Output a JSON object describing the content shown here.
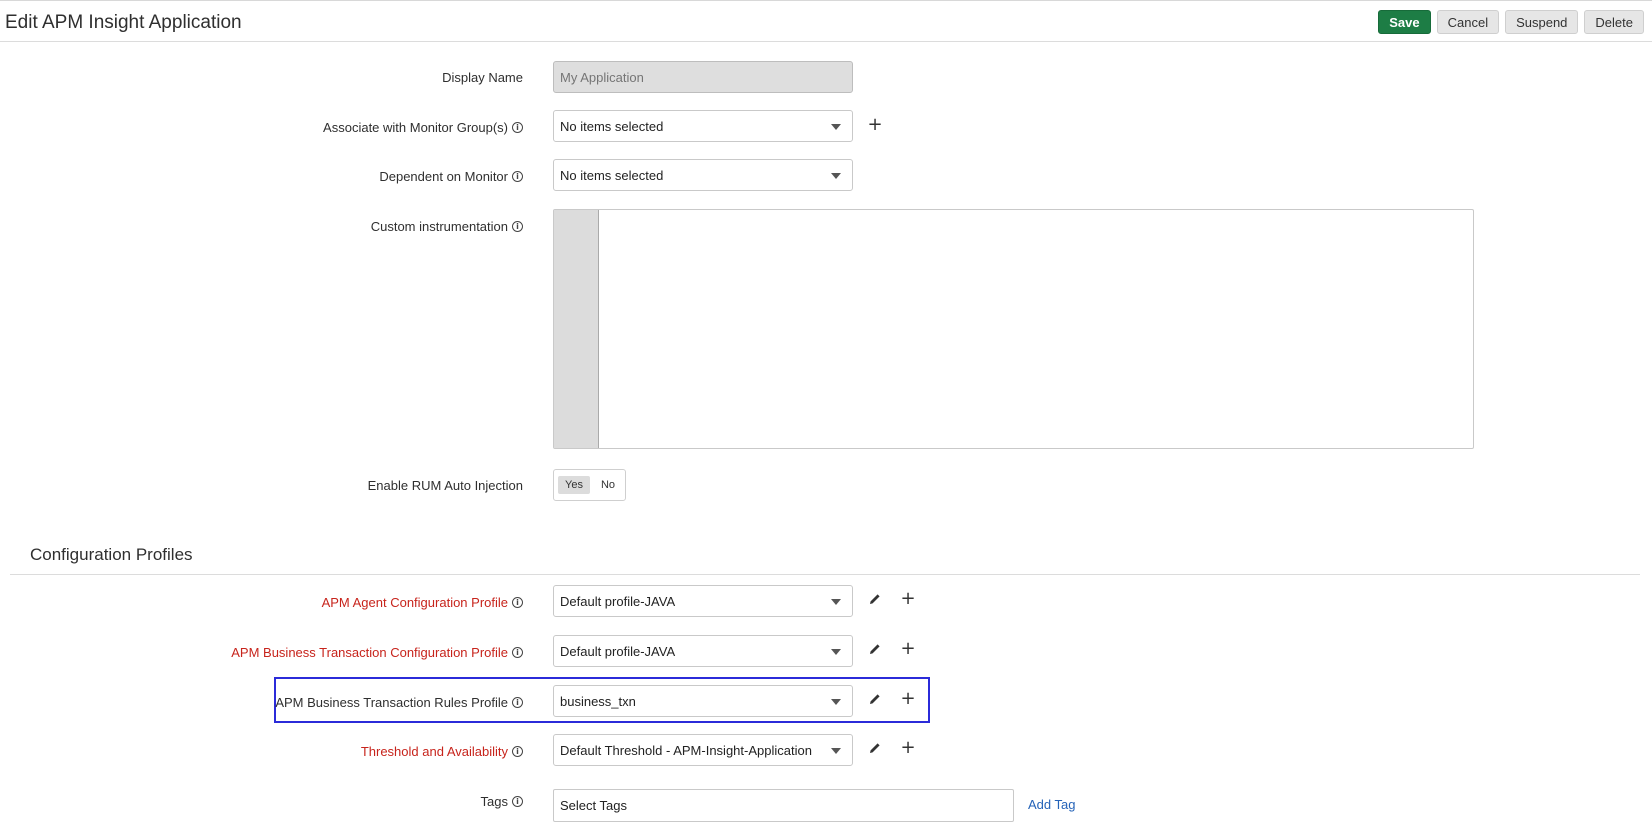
{
  "header": {
    "title": "Edit APM Insight Application",
    "buttons": {
      "save": "Save",
      "cancel": "Cancel",
      "suspend": "Suspend",
      "delete": "Delete"
    }
  },
  "form": {
    "display_name": {
      "label": "Display Name",
      "placeholder": "My Application"
    },
    "monitor_groups": {
      "label": "Associate with Monitor Group(s)",
      "value": "No items selected"
    },
    "dependent_monitor": {
      "label": "Dependent on Monitor",
      "value": "No items selected"
    },
    "custom_instrumentation": {
      "label": "Custom instrumentation"
    },
    "rum_injection": {
      "label": "Enable RUM Auto Injection",
      "yes": "Yes",
      "no": "No",
      "selected": "Yes"
    }
  },
  "config_profiles": {
    "title": "Configuration Profiles",
    "agent_profile": {
      "label": "APM Agent Configuration Profile",
      "value": "Default profile-JAVA"
    },
    "bt_config_profile": {
      "label": "APM Business Transaction Configuration Profile",
      "value": "Default profile-JAVA"
    },
    "bt_rules_profile": {
      "label": "APM Business Transaction Rules Profile",
      "value": "business_txn"
    },
    "threshold": {
      "label": "Threshold and Availability",
      "value": "Default Threshold - APM-Insight-Application"
    },
    "tags": {
      "label": "Tags",
      "placeholder": "Select Tags",
      "add_label": "Add Tag"
    }
  },
  "info_glyph": "i",
  "colors": {
    "primary": "#1d7d45",
    "required": "#c7241c",
    "highlight": "#2b2bd9",
    "link": "#2563b8"
  }
}
